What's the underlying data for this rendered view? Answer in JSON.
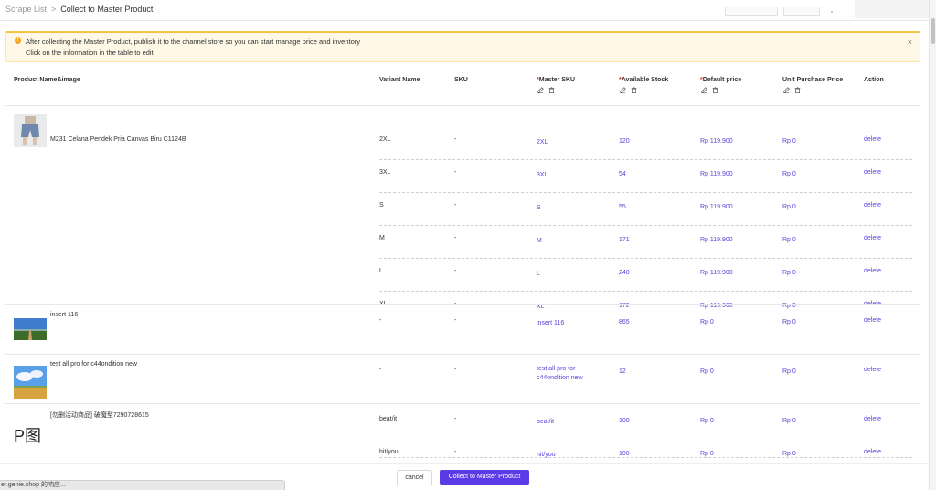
{
  "breadcrumb": {
    "link": "Scrape List",
    "separator": ">",
    "current": "Collect to Master Product"
  },
  "alert": {
    "line1": "After collecting the Master Product, publish it to the channel store so you can start manage price and inventory",
    "line2": "Click on the information in the table to edit.",
    "icon": "info-icon",
    "close": "×"
  },
  "table": {
    "headers": {
      "product": "Product Name&image",
      "variant": "Variant Name",
      "sku": "SKU",
      "master_sku": "Master SKU",
      "stock": "Available Stock",
      "price": "Default price",
      "purchase": "Unit Purchase Price",
      "action": "Action",
      "required_mark": "*"
    },
    "header_icons": [
      "edit-icon",
      "trash-icon"
    ],
    "action_label": "delete",
    "products": [
      {
        "name": "M231 Celana Pendek Pria Canvas Biru C1124B",
        "image": "shorts-photo",
        "variants": [
          {
            "variant": "2XL",
            "sku": "-",
            "master_sku": "2XL",
            "stock": "120",
            "price": "Rp 119.900",
            "purchase": "Rp 0"
          },
          {
            "variant": "3XL",
            "sku": "-",
            "master_sku": "3XL",
            "stock": "54",
            "price": "Rp 119.900",
            "purchase": "Rp 0"
          },
          {
            "variant": "S",
            "sku": "-",
            "master_sku": "S",
            "stock": "55",
            "price": "Rp 119.900",
            "purchase": "Rp 0"
          },
          {
            "variant": "M",
            "sku": "-",
            "master_sku": "M",
            "stock": "171",
            "price": "Rp 119.900",
            "purchase": "Rp 0"
          },
          {
            "variant": "L",
            "sku": "-",
            "master_sku": "L",
            "stock": "240",
            "price": "Rp 119.900",
            "purchase": "Rp 0"
          },
          {
            "variant": "XL",
            "sku": "-",
            "master_sku": "XL",
            "stock": "172",
            "price": "Rp 119.900",
            "purchase": "Rp 0"
          }
        ]
      },
      {
        "name": "insert 116",
        "image": "landscape-photo",
        "variants": [
          {
            "variant": "-",
            "sku": "-",
            "master_sku": "insert 116",
            "stock": "865",
            "price": "Rp 0",
            "purchase": "Rp 0"
          }
        ]
      },
      {
        "name": "test all pro for c44ondition new",
        "image": "field-photo",
        "variants": [
          {
            "variant": "-",
            "sku": "-",
            "master_sku": "test all pro for c44ondition new",
            "stock": "12",
            "price": "Rp 0",
            "purchase": "Rp 0"
          }
        ]
      },
      {
        "name": "[勿删活动商品] 破魔型7290728615",
        "image": "p-tu-image",
        "image_text": "P图",
        "variants": [
          {
            "variant": "beat/it",
            "sku": "-",
            "master_sku": "beat/it",
            "stock": "100",
            "price": "Rp 0",
            "purchase": "Rp 0"
          },
          {
            "variant": "hit/you",
            "sku": "-",
            "master_sku": "hit/you",
            "stock": "100",
            "price": "Rp 0",
            "purchase": "Rp 0"
          }
        ]
      }
    ]
  },
  "footer": {
    "cancel": "cancel",
    "submit": "Collect to Master Product"
  },
  "status_bar": "er.genie.shop 的响应...",
  "colors": {
    "accent": "#5b3be6",
    "link": "#5a3fd9",
    "warning": "#f5a623",
    "required": "#f5222d"
  }
}
